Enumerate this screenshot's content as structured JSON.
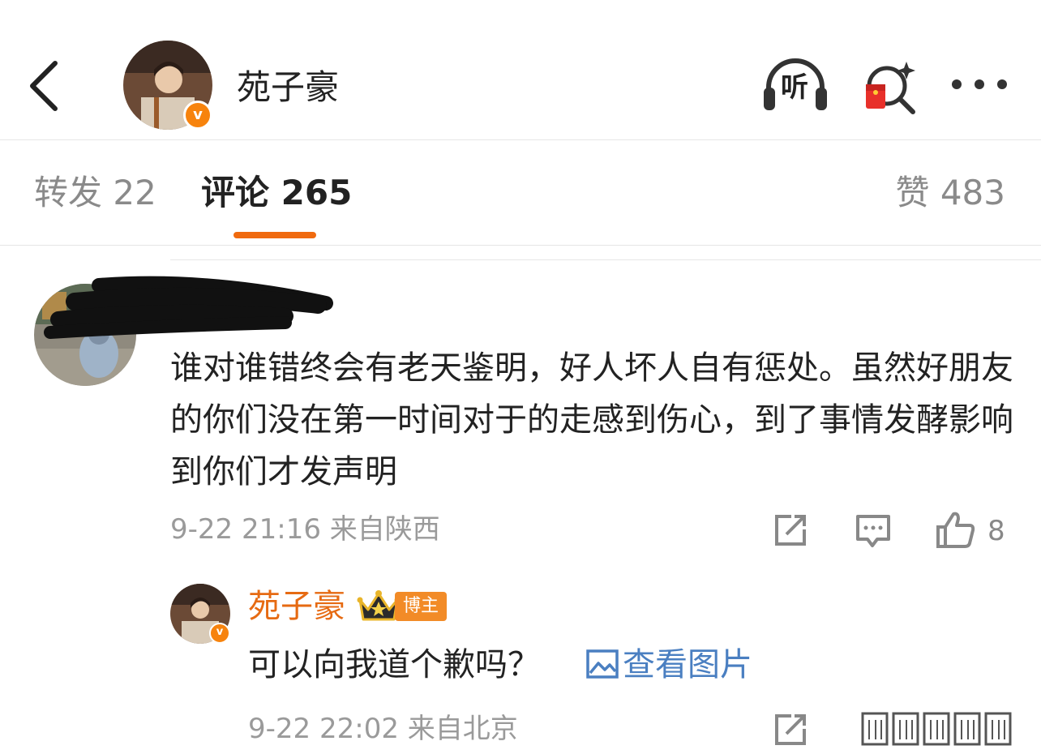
{
  "header": {
    "title": "苑子豪",
    "listen_label": "听",
    "icons": [
      "back-chevron-icon",
      "listen-headphones-icon",
      "red-packet-search-icon",
      "more-dots-icon"
    ]
  },
  "tabs": {
    "repost_label": "转发 22",
    "comments_label": "评论 265",
    "likes_label": "赞 483",
    "active": "评论"
  },
  "comment": {
    "author_redacted": true,
    "text": "谁对谁错终会有老天鉴明，好人坏人自有惩处。虽然好朋友的你们没在第一时间对于的走感到伤心，到了事情发酵影响到你们才发声明",
    "meta": "9-22 21:16 来自陕西",
    "like_count": "8"
  },
  "reply": {
    "author": "苑子豪",
    "badge": "博主",
    "text": "可以向我道个歉吗？",
    "link_label": "查看图片",
    "meta": "9-22 22:02 来自北京"
  },
  "colors": {
    "accent_orange": "#f06a0f",
    "name_orange": "#e66a12",
    "link_blue": "#4a7fc1",
    "muted_gray": "#9a9a9a",
    "badge_bg": "#f28b27"
  }
}
